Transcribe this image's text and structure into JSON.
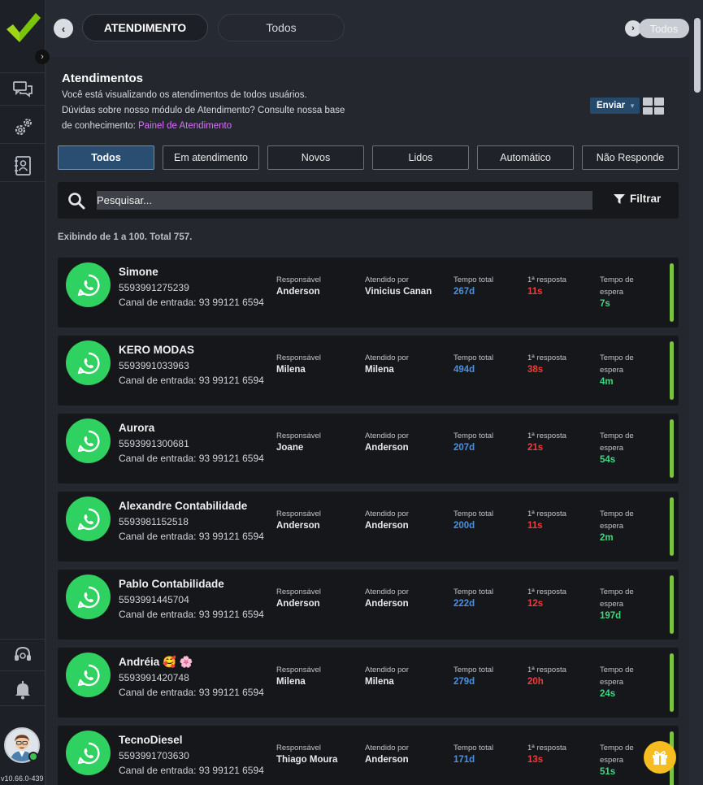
{
  "app": {
    "version": "v10.66.0-439",
    "accent": "#2a4e72",
    "brand_check_color": "#9fd61a"
  },
  "header": {
    "back_icon": "chevron-left-icon",
    "tabs": [
      {
        "label": "ATENDIMENTO",
        "active": true
      },
      {
        "label": "Todos",
        "active": false
      }
    ],
    "right_tag": "Todos"
  },
  "page": {
    "title": "Atendimentos",
    "desc_line1": "Você está visualizando os atendimentos de todos usuários.",
    "desc_line2": "Dúvidas sobre nosso módulo de Atendimento? Consulte nossa base",
    "desc_line3": "de conhecimento:",
    "link_text": "Painel de Atendimento",
    "send_label": "Enviar",
    "filters": [
      "Todos",
      "Em atendimento",
      "Novos",
      "Lidos",
      "Automático",
      "Não Responde"
    ],
    "active_filter": "Todos",
    "search_placeholder": "Pesquisar...",
    "filter_label": "Filtrar",
    "summary": "Exibindo de 1 a 100. Total 757."
  },
  "labels": {
    "responsavel": "Responsável",
    "atendido_por": "Atendido por",
    "tempo_total": "Tempo total",
    "primeira_resposta": "1ª resposta",
    "tempo_espera_1": "Tempo de",
    "tempo_espera_2": "espera"
  },
  "contacts": [
    {
      "name": "Simone",
      "phone": "5593991275239",
      "channel": "Canal de entrada: 93 99121 6594",
      "responsavel": "Anderson",
      "atendido_por": "Vinicius Canan",
      "tempo_total": "267d",
      "primeira_resposta": "11s",
      "tempo_espera": "7s"
    },
    {
      "name": "KERO MODAS",
      "phone": "5593991033963",
      "channel": "Canal de entrada: 93 99121 6594",
      "responsavel": "Milena",
      "atendido_por": "Milena",
      "tempo_total": "494d",
      "primeira_resposta": "38s",
      "tempo_espera": "4m"
    },
    {
      "name": "Aurora",
      "phone": "5593991300681",
      "channel": "Canal de entrada: 93 99121 6594",
      "responsavel": "Joane",
      "atendido_por": "Anderson",
      "tempo_total": "207d",
      "primeira_resposta": "21s",
      "tempo_espera": "54s"
    },
    {
      "name": "Alexandre Contabilidade",
      "phone": "5593981152518",
      "channel": "Canal de entrada: 93 99121 6594",
      "responsavel": "Anderson",
      "atendido_por": "Anderson",
      "tempo_total": "200d",
      "primeira_resposta": "11s",
      "tempo_espera": "2m"
    },
    {
      "name": "Pablo Contabilidade",
      "phone": "5593991445704",
      "channel": "Canal de entrada: 93 99121 6594",
      "responsavel": "Anderson",
      "atendido_por": "Anderson",
      "tempo_total": "222d",
      "primeira_resposta": "12s",
      "tempo_espera": "197d"
    },
    {
      "name": "Andréia 🥰 🌸",
      "phone": "5593991420748",
      "channel": "Canal de entrada: 93 99121 6594",
      "responsavel": "Milena",
      "atendido_por": "Milena",
      "tempo_total": "279d",
      "primeira_resposta": "20h",
      "tempo_espera": "24s"
    },
    {
      "name": "TecnoDiesel",
      "phone": "5593991703630",
      "channel": "Canal de entrada: 93 99121 6594",
      "responsavel": "Thiago Moura",
      "atendido_por": "Anderson",
      "tempo_total": "171d",
      "primeira_resposta": "13s",
      "tempo_espera": "51s"
    }
  ]
}
